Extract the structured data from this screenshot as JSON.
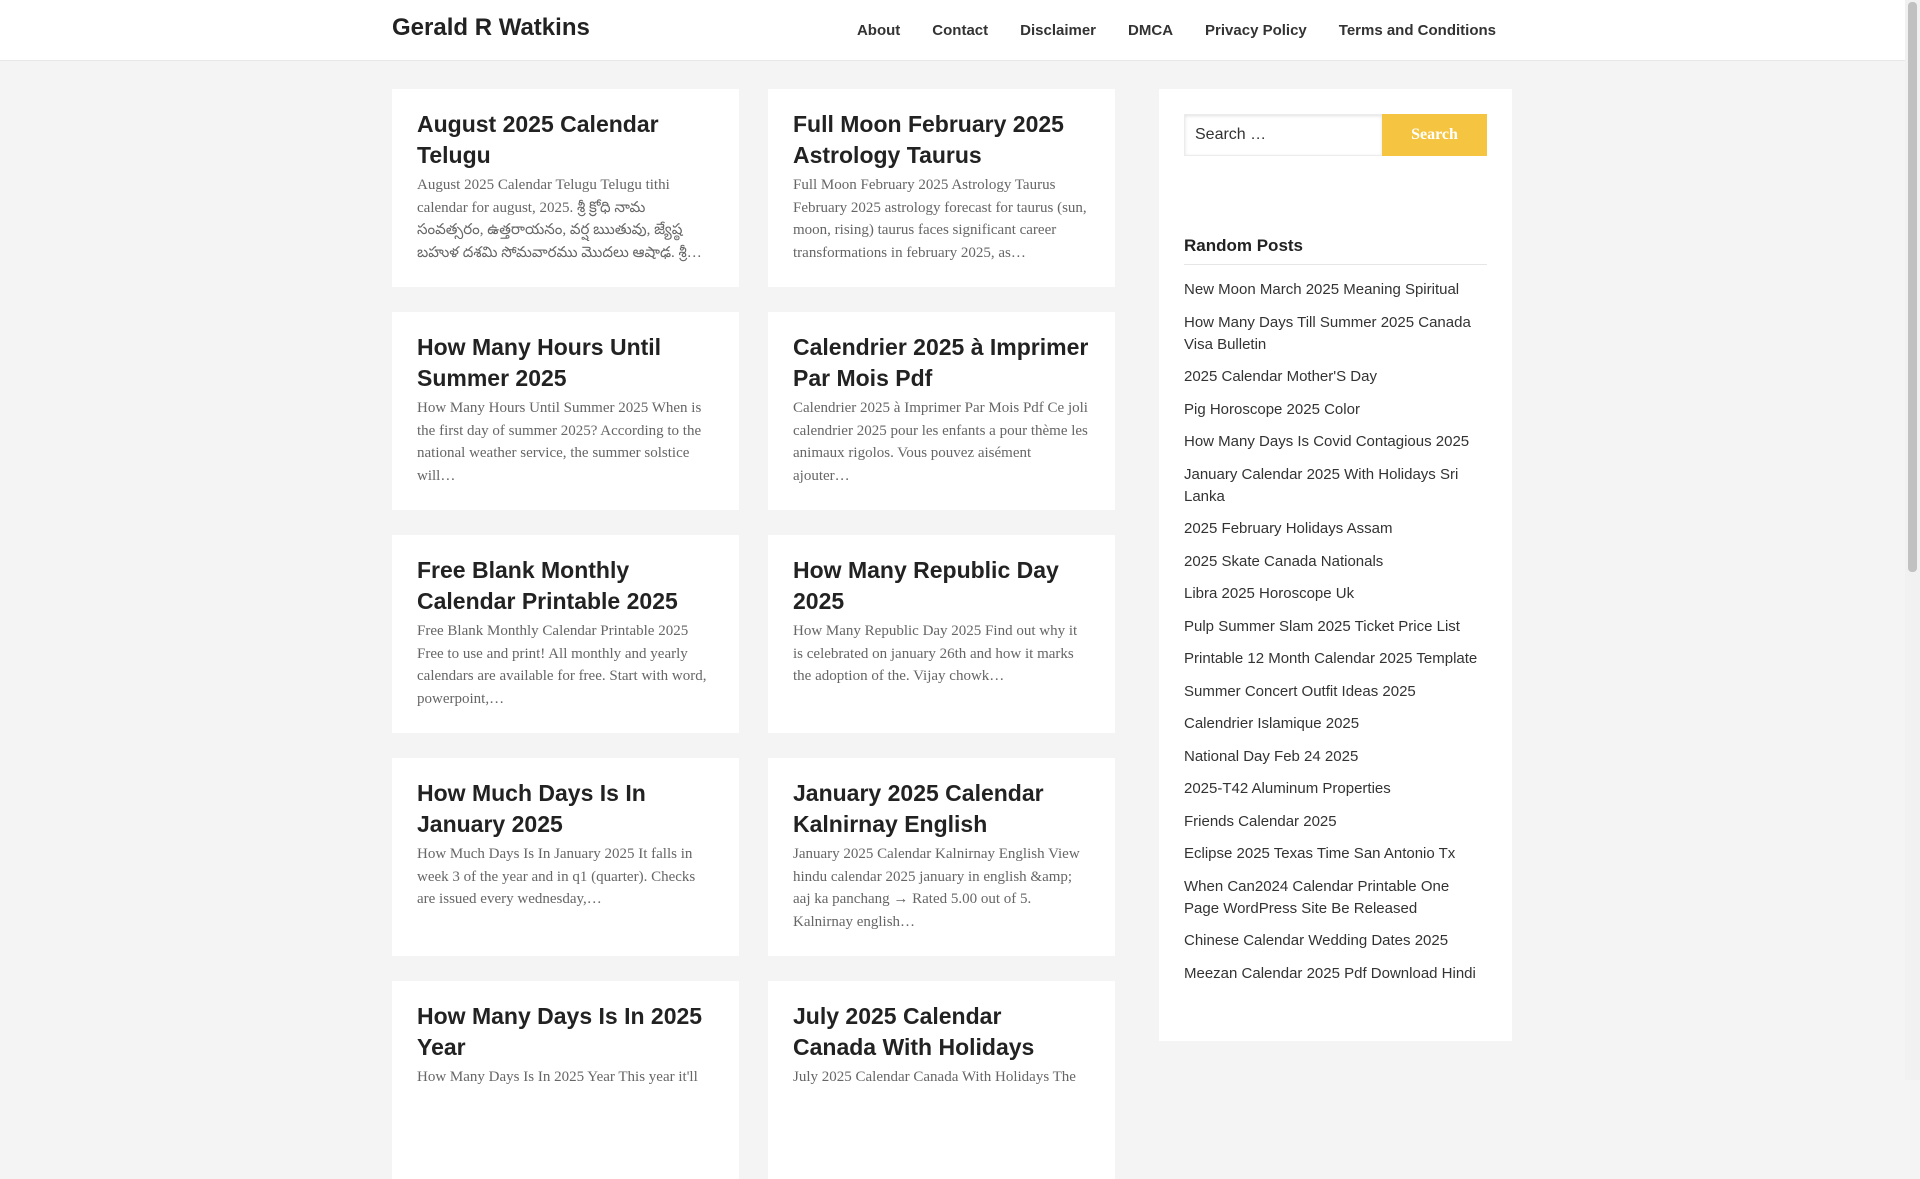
{
  "header": {
    "site_title": "Gerald R Watkins",
    "nav": [
      "About",
      "Contact",
      "Disclaimer",
      "DMCA",
      "Privacy Policy",
      "Terms and Conditions"
    ]
  },
  "posts": [
    {
      "title": "August 2025 Calendar Telugu",
      "excerpt": "August 2025 Calendar Telugu Telugu tithi calendar for august, 2025. శ్రీ క్రోధి నామ సంవత్సరం, ఉత్తరాయనం, వర్ష ఋతువు, జ్యేష్ఠ బహుళ దశమి సోమవారము మొదలు ఆషాఢ. శ్రీ…"
    },
    {
      "title": "Full Moon February 2025 Astrology Taurus",
      "excerpt": "Full Moon February 2025 Astrology Taurus February 2025 astrology forecast for taurus (sun, moon, rising) taurus faces significant career transformations in february 2025, as…"
    },
    {
      "title": "How Many Hours Until Summer 2025",
      "excerpt": "How Many Hours Until Summer 2025 When is the first day of summer 2025? According to the national weather service, the summer solstice will…"
    },
    {
      "title": "Calendrier 2025 à Imprimer Par Mois Pdf",
      "excerpt": "Calendrier 2025 à Imprimer Par Mois Pdf Ce joli calendrier 2025 pour les enfants a pour thème les animaux rigolos. Vous pouvez aisément ajouter…"
    },
    {
      "title": "Free Blank Monthly Calendar Printable 2025",
      "excerpt": "Free Blank Monthly Calendar Printable 2025 Free to use and print! All monthly and yearly calendars are available for free. Start with word, powerpoint,…"
    },
    {
      "title": "How Many Republic Day 2025",
      "excerpt": "How Many Republic Day 2025 Find out why it is celebrated on january 26th and how it marks the adoption of the. Vijay chowk…"
    },
    {
      "title": "How Much Days Is In January 2025",
      "excerpt": "How Much Days Is In January 2025 It falls in week 3 of the year and in q1 (quarter). Checks are issued every wednesday,…"
    },
    {
      "title": "January 2025 Calendar Kalnirnay English",
      "excerpt": "January 2025 Calendar Kalnirnay English View hindu calendar 2025 january in english &amp; aaj ka panchang → Rated 5.00 out of 5. Kalnirnay english…"
    },
    {
      "title": "How Many Days Is In 2025 Year",
      "excerpt": "How Many Days Is In 2025 Year This year it'll"
    },
    {
      "title": "July 2025 Calendar Canada With Holidays",
      "excerpt": "July 2025 Calendar Canada With Holidays The"
    }
  ],
  "sidebar": {
    "search_placeholder": "Search …",
    "search_button": "Search",
    "random_posts_title": "Random Posts",
    "random_posts": [
      "New Moon March 2025 Meaning Spiritual",
      "How Many Days Till Summer 2025 Canada Visa Bulletin",
      "2025 Calendar Mother'S Day",
      "Pig Horoscope 2025 Color",
      "How Many Days Is Covid Contagious 2025",
      "January Calendar 2025 With Holidays Sri Lanka",
      "2025 February Holidays Assam",
      "2025 Skate Canada Nationals",
      "Libra 2025 Horoscope Uk",
      "Pulp Summer Slam 2025 Ticket Price List",
      "Printable 12 Month Calendar 2025 Template",
      "Summer Concert Outfit Ideas 2025",
      "Calendrier Islamique 2025",
      "National Day Feb 24 2025",
      "2025-T42 Aluminum Properties",
      "Friends Calendar 2025",
      "Eclipse 2025 Texas Time San Antonio Tx",
      "When Can2024 Calendar Printable One Page WordPress Site Be Released",
      "Chinese Calendar Wedding Dates 2025",
      "Meezan Calendar 2025 Pdf Download Hindi"
    ]
  },
  "colors": {
    "page_background": "#f4f4f4",
    "search_button": "#f5c542",
    "card_background": "#ffffff"
  }
}
